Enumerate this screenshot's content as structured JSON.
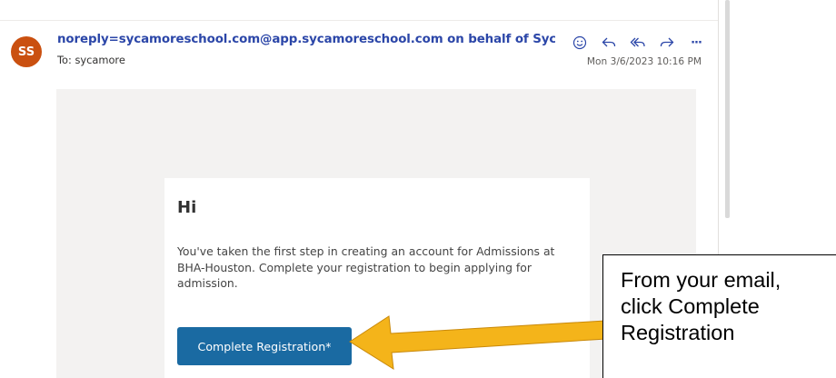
{
  "message": {
    "avatar_initials": "SS",
    "avatar_color": "#ca5010",
    "sender": "noreply=sycamoreschool.com@app.sycamoreschool.com on behalf of Sycamore S",
    "to_prefix": "To:",
    "to": "sycamore",
    "date": "Mon 3/6/2023 10:16 PM",
    "actions": [
      {
        "icon": "smiley-icon"
      },
      {
        "icon": "reply-icon"
      },
      {
        "icon": "reply-all-icon"
      },
      {
        "icon": "forward-icon"
      },
      {
        "icon": "more-icon",
        "label": "···"
      }
    ]
  },
  "email_body": {
    "greeting": "Hi",
    "text": "You've taken the first step in creating an account for Admissions at BHA-Houston. Complete your registration to begin applying for admission.",
    "button_label": "Complete Registration*",
    "button_color": "#1a6aa2"
  },
  "annotation": {
    "lines": [
      "From your email,",
      "click Complete",
      "Registration"
    ],
    "arrow_color": "#f4b41a",
    "arrow_icon": "arrow-left-icon"
  }
}
